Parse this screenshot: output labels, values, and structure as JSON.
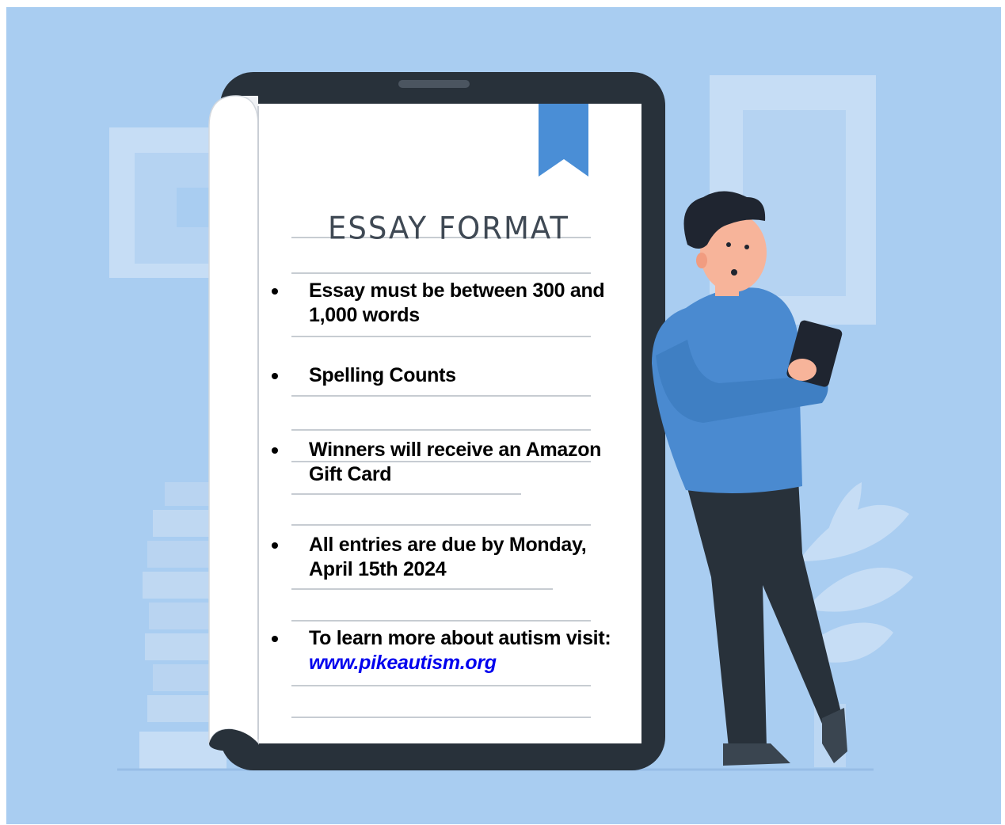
{
  "title": "ESSAY FORMAT",
  "bullets": [
    {
      "text": "Essay must be between 300 and 1,000 words"
    },
    {
      "text": "Spelling Counts"
    },
    {
      "text": "Winners will receive an Amazon Gift Card"
    },
    {
      "text": "All entries are due by Monday, April 15th 2024"
    },
    {
      "text": "To learn more about autism visit:",
      "link": "www.pikeautism.org"
    }
  ],
  "colors": {
    "background": "#a9cdf1",
    "tablet_frame": "#28313a",
    "bookmark": "#4a8ed6",
    "shirt": "#4a8ad0",
    "link": "#0000ee"
  },
  "icons": [
    "tablet-icon",
    "bookmark-icon",
    "person-illustration",
    "plant-illustration",
    "book-stack-illustration",
    "picture-frame-illustration"
  ]
}
